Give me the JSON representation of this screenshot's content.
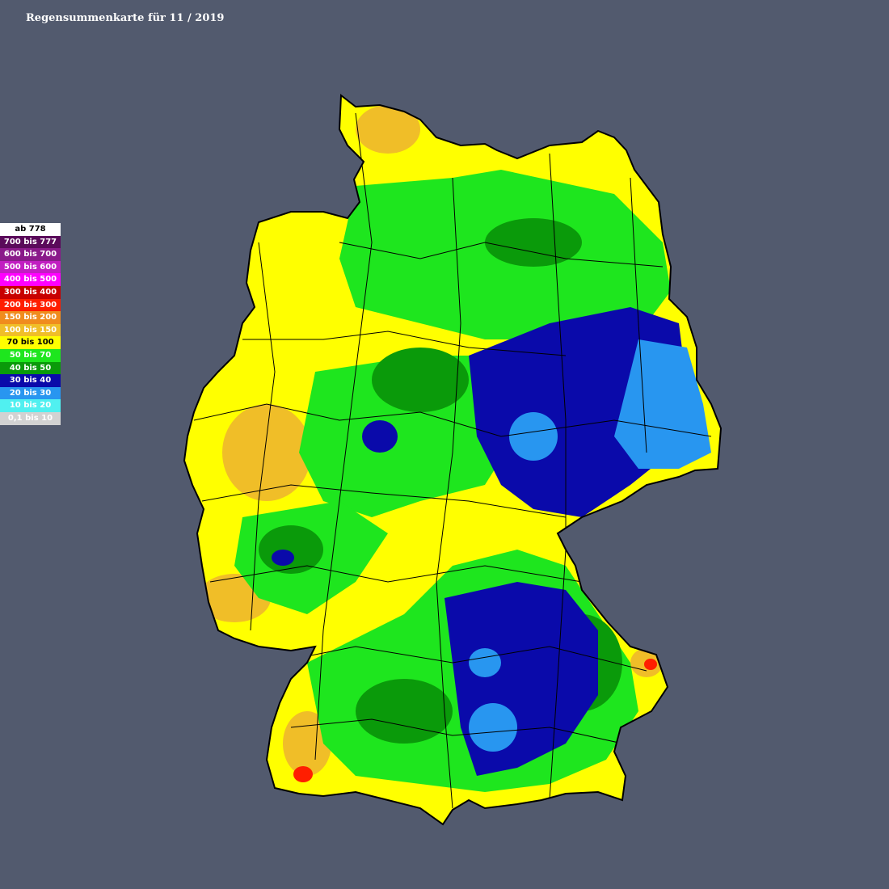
{
  "title": "Regensummenkarte für 11 / 2019",
  "legend": [
    {
      "label": "ab 778",
      "color": "#ffffff",
      "text": "#000000"
    },
    {
      "label": "700 bis 777",
      "color": "#5a0a5a",
      "text": "#ffffff"
    },
    {
      "label": "600 bis 700",
      "color": "#8a1a8a",
      "text": "#ffffff"
    },
    {
      "label": "500 bis 600",
      "color": "#c21ec2",
      "text": "#ffffff"
    },
    {
      "label": "400 bis 500",
      "color": "#ff00ff",
      "text": "#ffffff"
    },
    {
      "label": "300 bis 400",
      "color": "#c80000",
      "text": "#ffffff"
    },
    {
      "label": "200 bis 300",
      "color": "#ff1e00",
      "text": "#ffffff"
    },
    {
      "label": "150 bis 200",
      "color": "#f08c1e",
      "text": "#ffffff"
    },
    {
      "label": "100 bis 150",
      "color": "#f0be28",
      "text": "#ffffff"
    },
    {
      "label": "70 bis 100",
      "color": "#ffff00",
      "text": "#000000"
    },
    {
      "label": "50 bis 70",
      "color": "#1ee61e",
      "text": "#ffffff"
    },
    {
      "label": "40 bis 50",
      "color": "#0a9a0a",
      "text": "#ffffff"
    },
    {
      "label": "30 bis 40",
      "color": "#0a0aaa",
      "text": "#ffffff"
    },
    {
      "label": "20 bis 30",
      "color": "#2896f0",
      "text": "#ffffff"
    },
    {
      "label": "10 bis 20",
      "color": "#50f0f0",
      "text": "#ffffff"
    },
    {
      "label": "0,1 bis 10",
      "color": "#d2d2d2",
      "text": "#ffffff"
    }
  ],
  "colors": {
    "background": "#525a6e",
    "border": "#000000"
  }
}
